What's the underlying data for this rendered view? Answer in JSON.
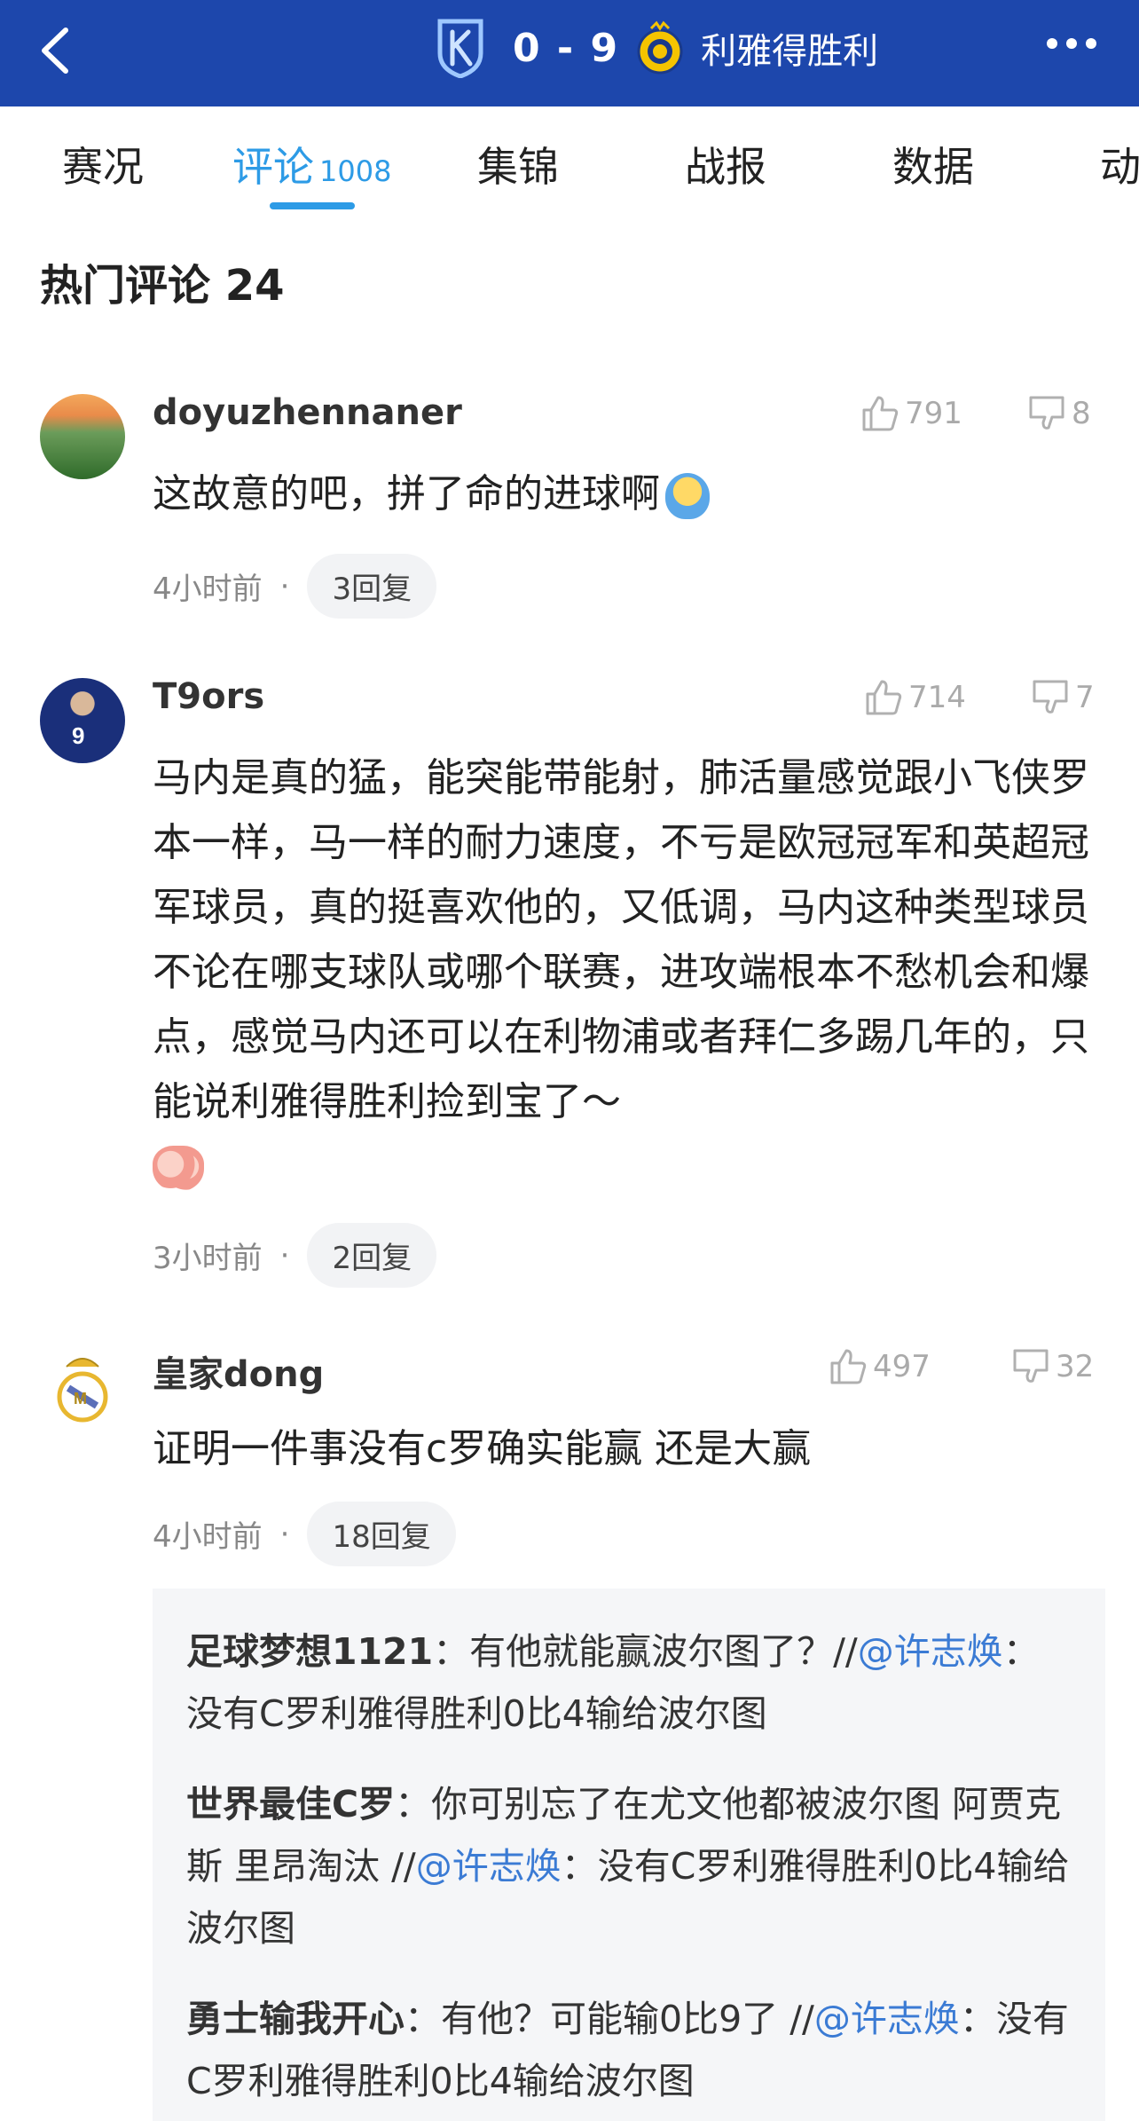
{
  "header": {
    "score": "0 - 9",
    "winner_label": "利雅得胜利",
    "away_logo_icon": "dalian-team-logo",
    "home_logo_icon": "al-nassr-logo"
  },
  "tabs": [
    {
      "label": "赛况"
    },
    {
      "label": "评论",
      "count": "1008"
    },
    {
      "label": "集锦"
    },
    {
      "label": "战报"
    },
    {
      "label": "数据"
    },
    {
      "label": "动"
    }
  ],
  "section_title": "热门评论 24",
  "comments": [
    {
      "username": "doyuzhennaner",
      "likes": "791",
      "dislikes": "8",
      "text": "这故意的吧，拼了命的进球啊",
      "time": "4小时前",
      "replies": "3回复"
    },
    {
      "username": "T9ors",
      "likes": "714",
      "dislikes": "7",
      "text": "马内是真的猛，能突能带能射，肺活量感觉跟小飞侠罗本一样，马一样的耐力速度，不亏是欧冠冠军和英超冠军球员，真的挺喜欢他的，又低调，马内这种类型球员不论在哪支球队或哪个联赛，进攻端根本不愁机会和爆点，感觉马内还可以在利物浦或者拜仁多踢几年的，只能说利雅得胜利捡到宝了～",
      "time": "3小时前",
      "replies": "2回复"
    },
    {
      "username": "皇家dong",
      "likes": "497",
      "dislikes": "32",
      "text": "证明一件事没有c罗确实能赢 还是大赢",
      "time": "4小时前",
      "replies": "18回复"
    }
  ],
  "sub_replies": [
    {
      "name": "足球梦想1121",
      "text": "有他就能赢波尔图了？//",
      "mention": "@许志焕",
      "quoted": "：没有C罗利雅得胜利0比4输给波尔图"
    },
    {
      "name": "世界最佳C罗",
      "text": "你可别忘了在尤文他都被波尔图 阿贾克斯 里昂淘汰 //",
      "mention": "@许志焕",
      "quoted": "：没有C罗利雅得胜利0比4输给波尔图"
    },
    {
      "name": "勇士输我开心",
      "text": "有他？可能输0比9了 //",
      "mention": "@许志焕",
      "quoted": "：没有C罗利雅得胜利0比4输给波尔图"
    }
  ],
  "colors": {
    "header_bg": "#1d47ac",
    "accent": "#2d9be6",
    "mention": "#3b7bd4"
  }
}
